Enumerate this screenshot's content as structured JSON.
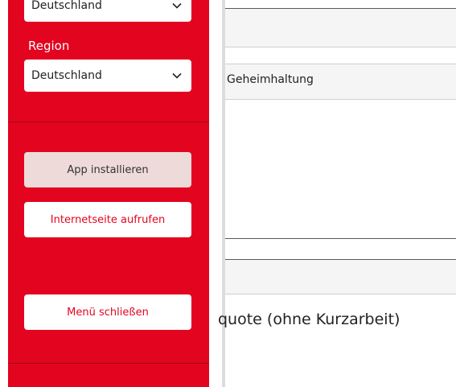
{
  "sidebar": {
    "country_select": {
      "value": "Deutschland"
    },
    "region_label": "Region",
    "region_select": {
      "value": "Deutschland"
    },
    "install_app_label": "App installieren",
    "open_website_label": "Internetseite aufrufen",
    "close_menu_label": "Menü schließen"
  },
  "background": {
    "row_label": "Geheimhaltung",
    "section_heading": "quote (ohne Kurzarbeit)"
  },
  "colors": {
    "accent": "#e30420",
    "install_button_bg": "#efdada"
  },
  "icons": {
    "select_chevron": "chevron-down-icon"
  }
}
